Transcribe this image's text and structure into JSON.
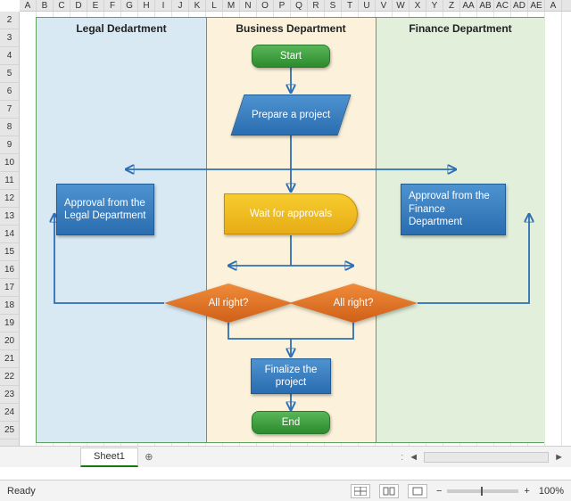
{
  "columns": [
    "A",
    "B",
    "C",
    "D",
    "E",
    "F",
    "G",
    "H",
    "I",
    "J",
    "K",
    "L",
    "M",
    "N",
    "O",
    "P",
    "Q",
    "R",
    "S",
    "T",
    "U",
    "V",
    "W",
    "X",
    "Y",
    "Z",
    "AA",
    "AB",
    "AC",
    "AD",
    "AE",
    "A"
  ],
  "rows": [
    "2",
    "3",
    "4",
    "5",
    "6",
    "7",
    "8",
    "9",
    "10",
    "11",
    "12",
    "13",
    "14",
    "15",
    "16",
    "17",
    "18",
    "19",
    "20",
    "21",
    "22",
    "23",
    "24",
    "25"
  ],
  "lanes": {
    "legal": {
      "title": "Legal Dedartment"
    },
    "business": {
      "title": "Business Department"
    },
    "finance": {
      "title": "Finance Department"
    }
  },
  "shapes": {
    "start": "Start",
    "prepare": "Prepare a project",
    "wait": "Wait for approvals",
    "approve_legal": "Approval from the Legal Department",
    "approve_finance": "Approval from the Finance Department",
    "decision_left": "All right?",
    "decision_right": "All right?",
    "finalize": "Finalize the project",
    "end": "End"
  },
  "sheet": {
    "tab1": "Sheet1",
    "addtab": "⊕"
  },
  "statusbar": {
    "status": "Ready",
    "zoom": "100%",
    "minus": "−",
    "plus": "+"
  },
  "scroll": {
    "left": "◄",
    "right": "►",
    "sep": ":"
  }
}
